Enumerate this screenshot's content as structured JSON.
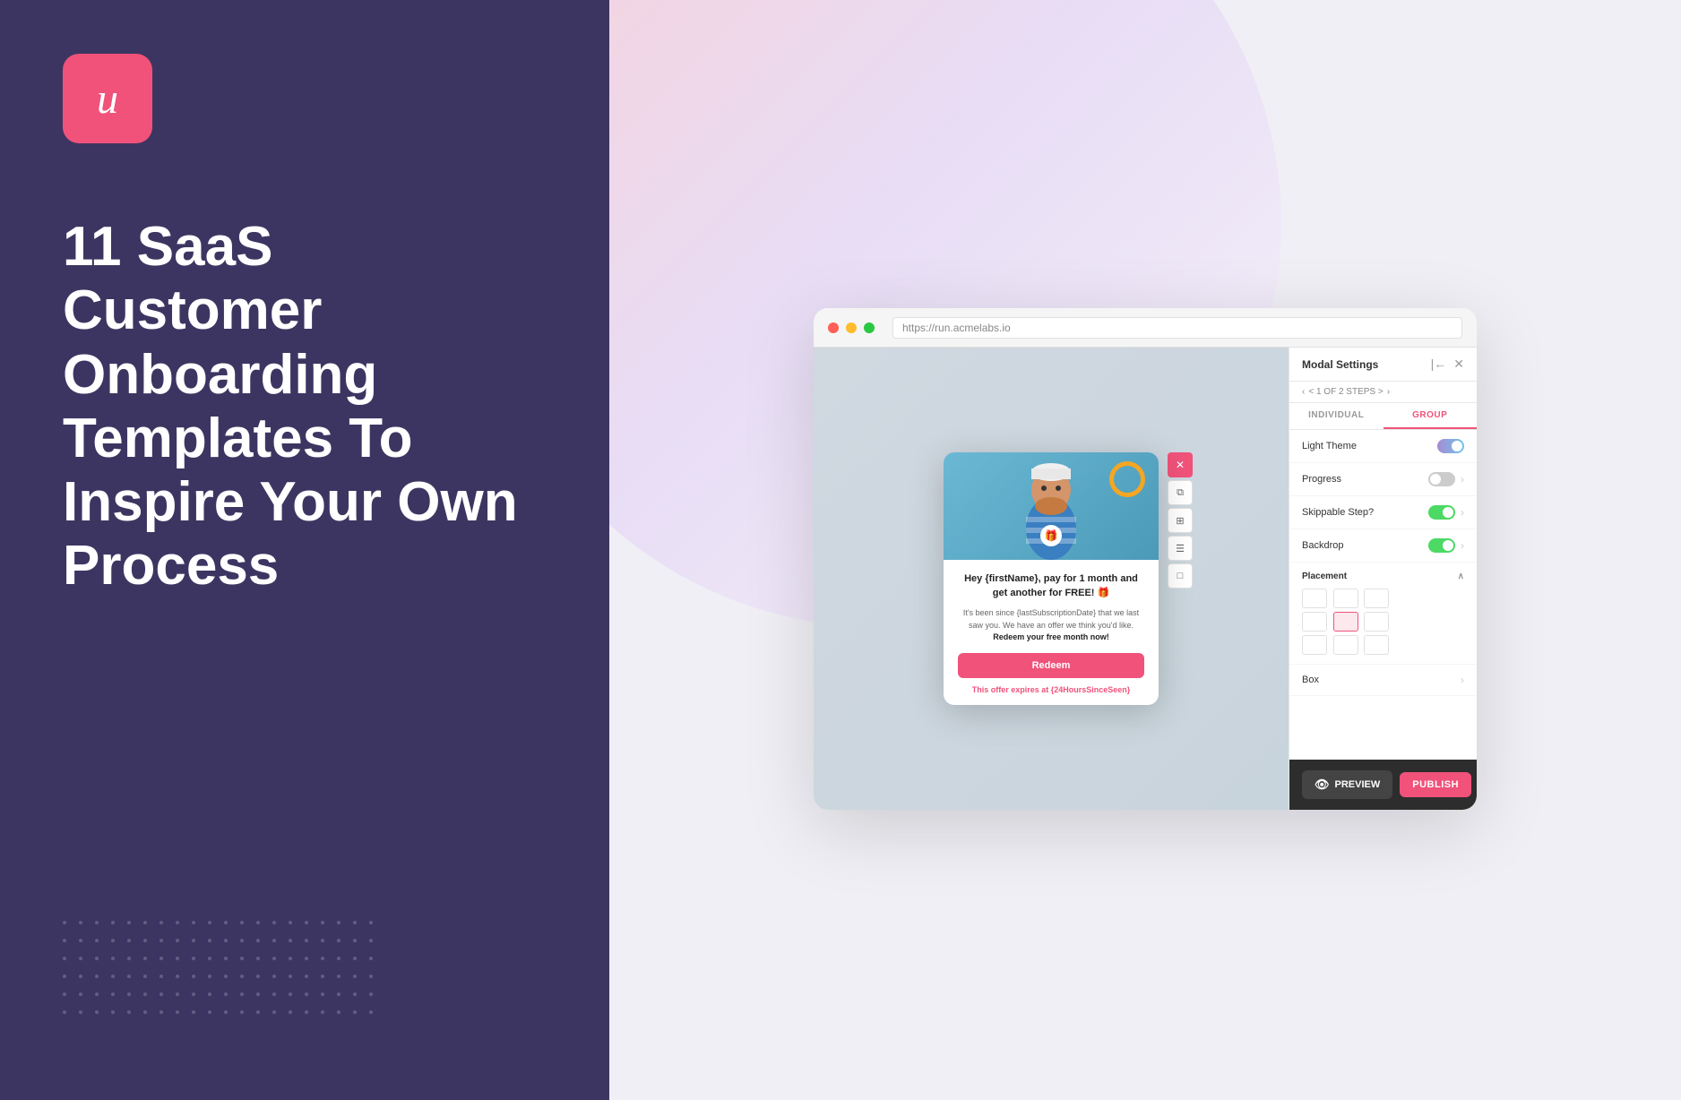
{
  "left": {
    "logo": "u",
    "headline": "11 SaaS Customer Onboarding Templates To Inspire Your Own Process"
  },
  "right": {
    "browser_url": "https://run.acmelabs.io",
    "modal": {
      "title": "Hey {firstName}, pay for 1 month and get another for FREE! 🎁",
      "desc_before": "It's been since {lastSubscriptionDate} that we last saw you. We have an offer we think you'd like.",
      "desc_link": "Redeem your free month now!",
      "button_label": "Redeem",
      "expiry_text": "This offer expires at {24HoursSinceSeen}"
    },
    "controls": [
      "×",
      "□",
      "□",
      "☰",
      "□"
    ],
    "settings": {
      "title": "Modal Settings",
      "steps_text": "< 1 OF 2 STEPS >",
      "tabs": [
        "INDIVIDUAL",
        "GROUP"
      ],
      "active_tab": "GROUP",
      "rows": [
        {
          "label": "Light Theme",
          "type": "toggle-theme",
          "has_chevron": false
        },
        {
          "label": "Progress",
          "type": "toggle-off",
          "has_chevron": true
        },
        {
          "label": "Skippable Step?",
          "type": "toggle-on",
          "has_chevron": true
        },
        {
          "label": "Backdrop",
          "type": "toggle-on",
          "has_chevron": true
        }
      ],
      "placement_label": "Placement",
      "placement_active": 4,
      "box_label": "Box",
      "actions": {
        "preview_label": "PREVIEW",
        "publish_label": "PUBLISH"
      }
    }
  }
}
